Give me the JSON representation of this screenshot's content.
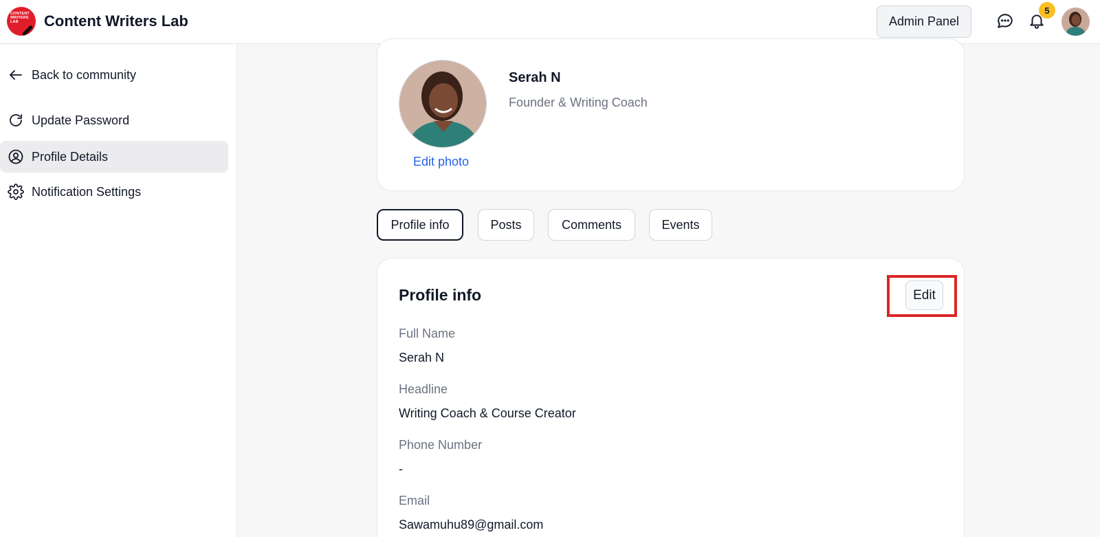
{
  "header": {
    "logo_text": "CONTENT WRITERS LAB",
    "app_title": "Content Writers Lab",
    "admin_button": "Admin Panel",
    "notification_count": "5"
  },
  "sidebar": {
    "items": [
      {
        "label": "Back to community",
        "icon": "arrow-left-icon"
      },
      {
        "label": "Update Password",
        "icon": "refresh-icon"
      },
      {
        "label": "Profile Details",
        "icon": "user-circle-icon",
        "active": true
      },
      {
        "label": "Notification Settings",
        "icon": "gear-icon"
      }
    ]
  },
  "profile": {
    "name": "Serah N",
    "role": "Founder & Writing Coach",
    "edit_photo": "Edit photo"
  },
  "tabs": [
    {
      "label": "Profile info",
      "active": true
    },
    {
      "label": "Posts"
    },
    {
      "label": "Comments"
    },
    {
      "label": "Events"
    }
  ],
  "info": {
    "title": "Profile info",
    "edit_label": "Edit",
    "fields": [
      {
        "label": "Full Name",
        "value": "Serah N"
      },
      {
        "label": "Headline",
        "value": "Writing Coach & Course Creator"
      },
      {
        "label": "Phone Number",
        "value": "-"
      },
      {
        "label": "Email",
        "value": "Sawamuhu89@gmail.com"
      }
    ]
  },
  "colors": {
    "accent_red": "#dc2626",
    "link_blue": "#2563eb",
    "badge_yellow": "#fbbf24"
  }
}
